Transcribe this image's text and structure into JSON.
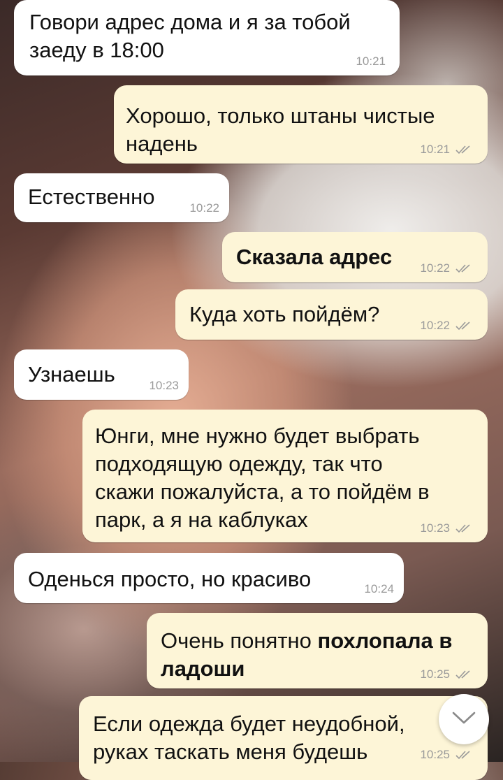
{
  "colors": {
    "incoming_bubble": "#ffffff",
    "outgoing_bubble": "#fdf5d7",
    "timestamp": "#9a9a9a"
  },
  "messages": [
    {
      "dir": "in",
      "text": "Говори адрес дома и я за тобой\nзаеду в 18:00",
      "time": "10:21"
    },
    {
      "dir": "out",
      "text": "Хорошо, только штаны чистые\nнадень",
      "time": "10:21",
      "status_icon": "double-check-icon"
    },
    {
      "dir": "in",
      "text": "Естественно",
      "time": "10:22"
    },
    {
      "dir": "out",
      "text": "Сказала адрес",
      "time": "10:22",
      "status_icon": "double-check-icon"
    },
    {
      "dir": "out",
      "text": "Куда хоть пойдём?",
      "time": "10:22",
      "status_icon": "double-check-icon"
    },
    {
      "dir": "in",
      "text": "Узнаешь",
      "time": "10:23"
    },
    {
      "dir": "out",
      "text": "Юнги, мне нужно будет выбрать\nподходящую одежду, так что\nскажи пожалуйста, а то пойдём в\nпарк, а я на каблуках",
      "time": "10:23",
      "status_icon": "double-check-icon"
    },
    {
      "dir": "in",
      "text": "Оденься просто, но красиво",
      "time": "10:24"
    },
    {
      "dir": "out",
      "text_plain": "Очень понятно ",
      "text_bold": "похлопала в\nладоши",
      "time": "10:25",
      "status_icon": "double-check-icon"
    },
    {
      "dir": "out",
      "text": "Если одежда будет неудобной, \nруках таскать меня будешь",
      "time": "10:25",
      "status_icon": "double-check-icon"
    }
  ],
  "scroll_button_icon": "chevron-down-icon"
}
